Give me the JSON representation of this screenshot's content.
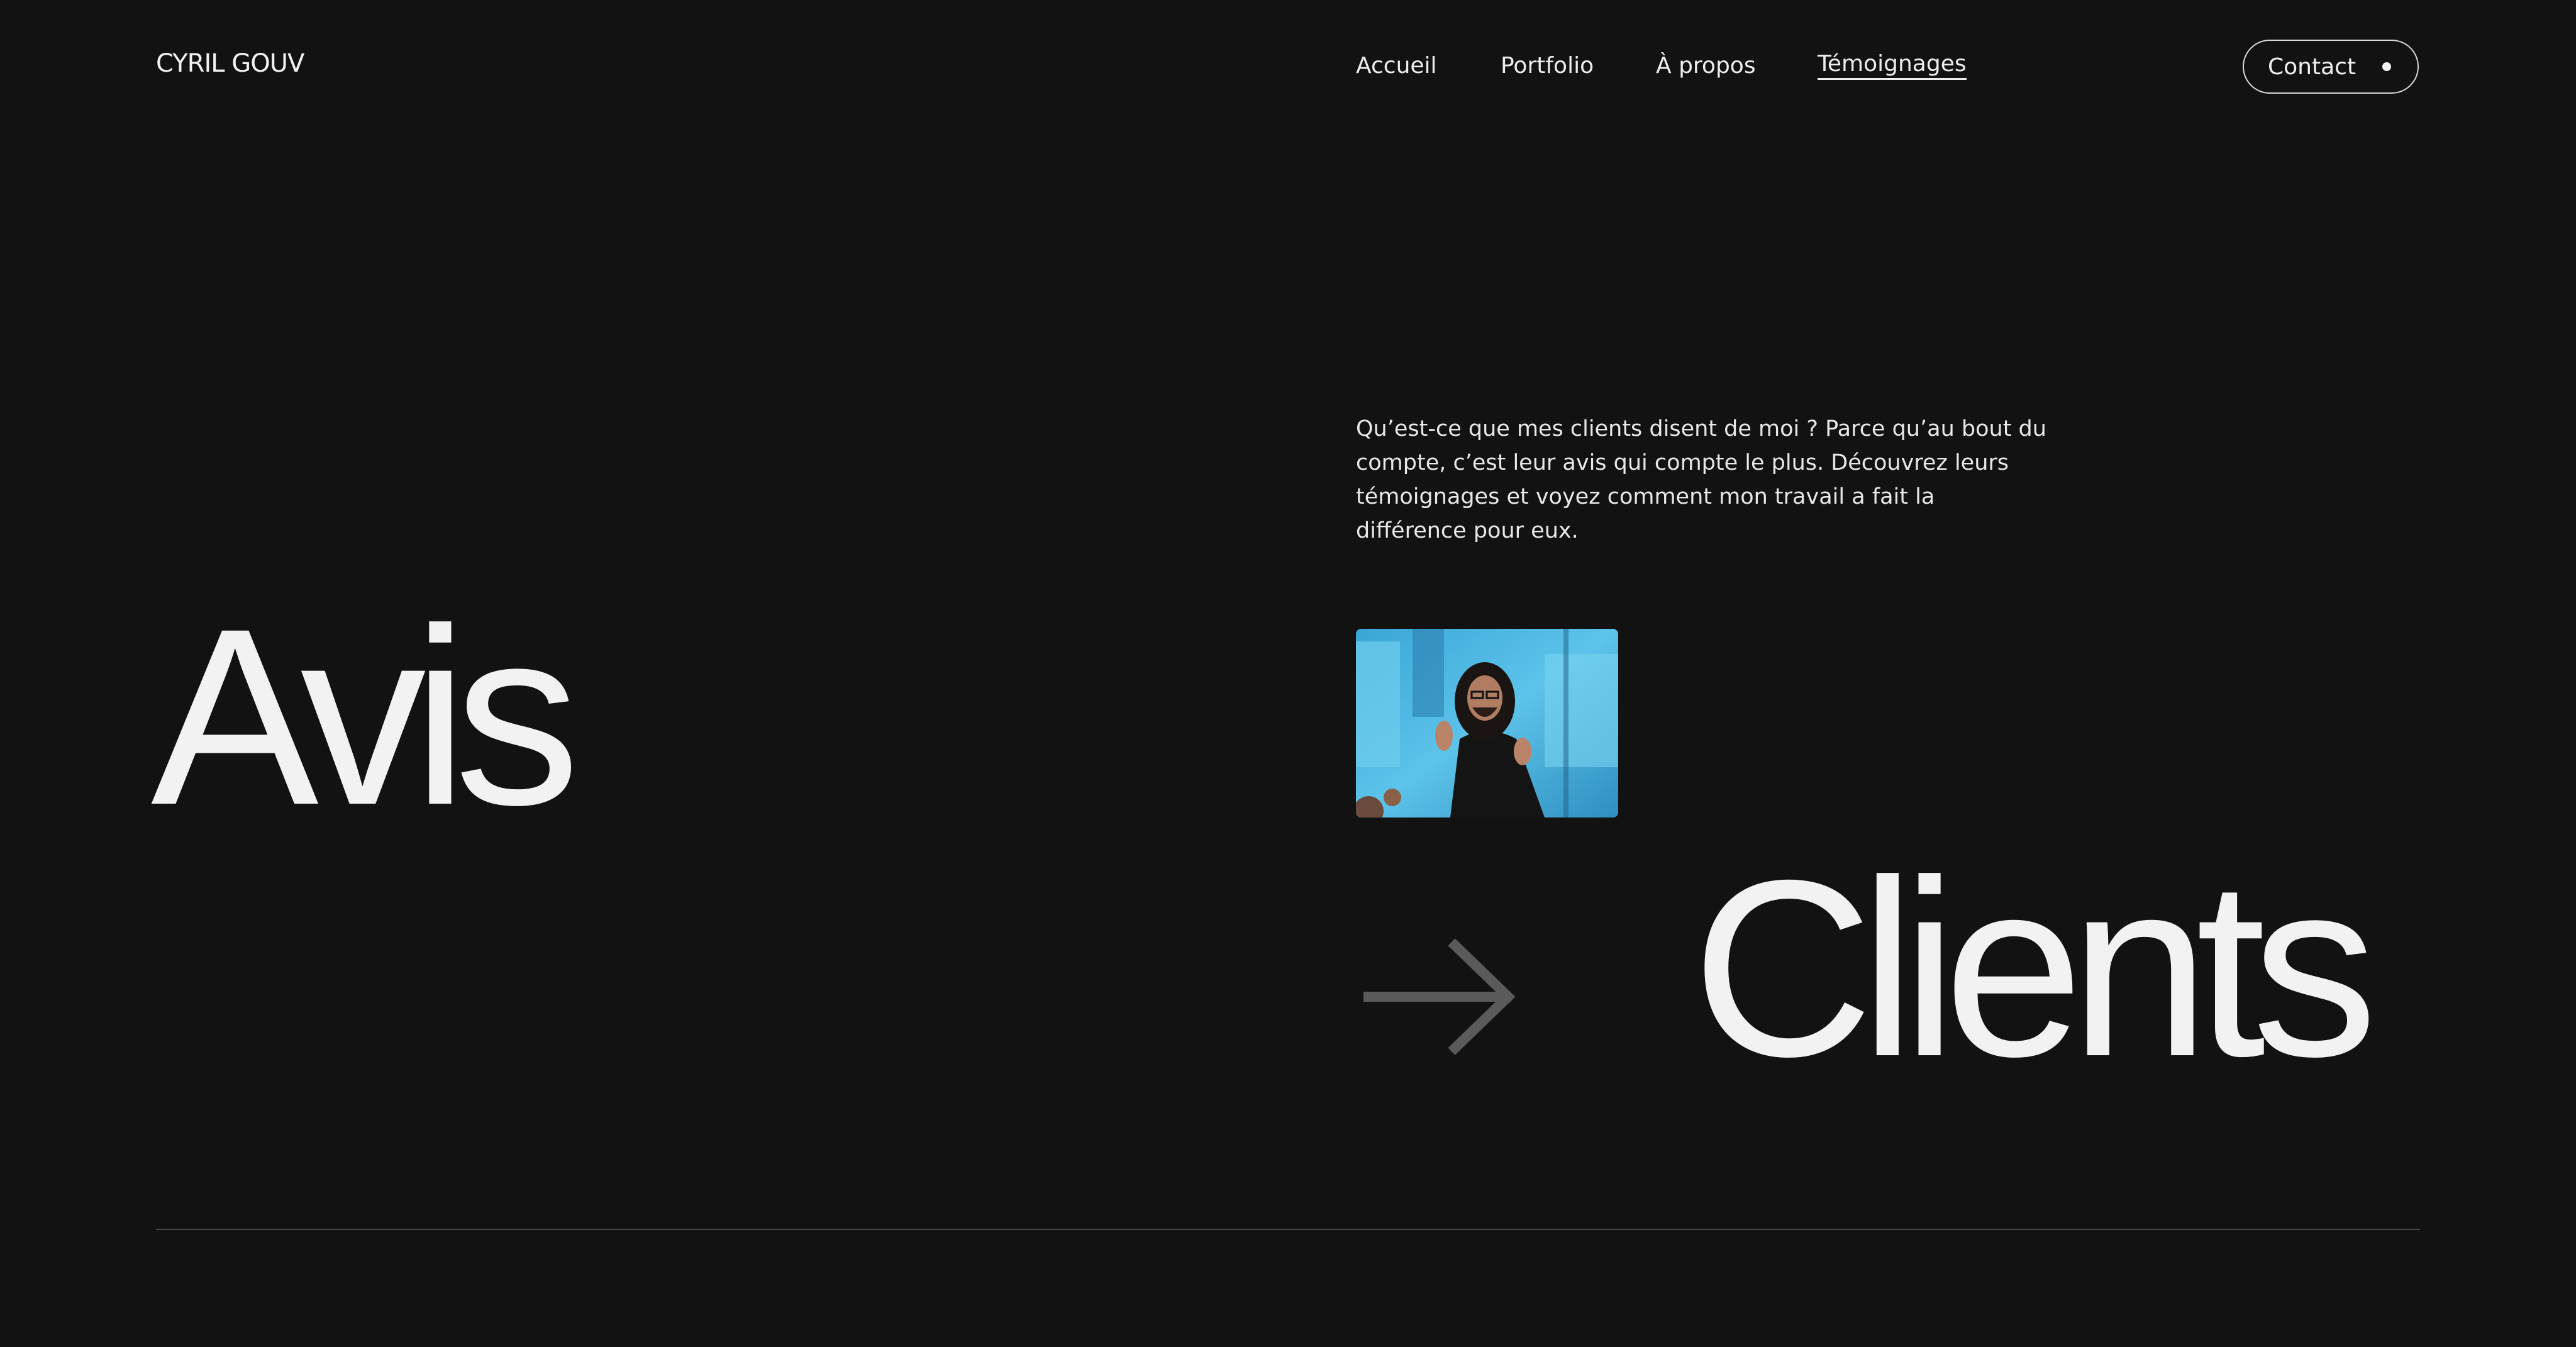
{
  "header": {
    "logo": "CYRIL GOUV",
    "nav": [
      {
        "label": "Accueil"
      },
      {
        "label": "Portfolio"
      },
      {
        "label": "À propos"
      },
      {
        "label": "Témoignages"
      }
    ],
    "active_nav": "Témoignages",
    "contact_label": "Contact"
  },
  "hero": {
    "intro": "Qu’est-ce que mes clients disent de moi ? Parce qu’au bout du compte, c’est leur avis qui compte le plus. Découvrez leurs témoignages et voyez comment mon travail a fait la différence pour eux.",
    "title_left": "Avis",
    "title_right": "Clients",
    "arrow_icon": "arrow-right-icon",
    "thumbnail": "video-thumbnail"
  },
  "colors": {
    "background": "#121212",
    "text": "#f2f2f2",
    "arrow": "#5a5a5a",
    "divider": "#4a4a4a",
    "thumb_bg": "#4fb6df"
  }
}
